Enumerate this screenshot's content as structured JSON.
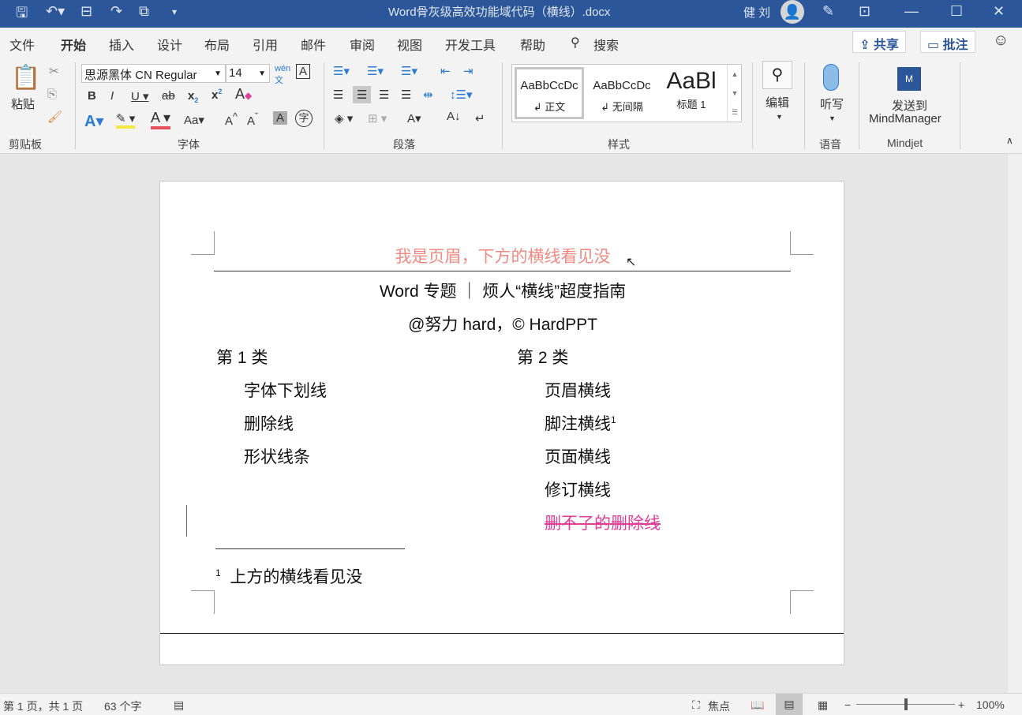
{
  "window": {
    "title": "Word骨灰级高效功能域代码（横线）.docx",
    "user": "健 刘"
  },
  "tabs": [
    "文件",
    "开始",
    "插入",
    "设计",
    "布局",
    "引用",
    "邮件",
    "审阅",
    "视图",
    "开发工具",
    "帮助"
  ],
  "search_label": "搜索",
  "share_label": "共享",
  "comment_label": "批注",
  "ribbon": {
    "paste": "粘贴",
    "clipboard": "剪贴板",
    "font_name": "思源黑体 CN Regular",
    "font_size": "14",
    "font_group": "字体",
    "paragraph_group": "段落",
    "styles": [
      {
        "preview": "AaBbCcDc",
        "name": "↲ 正文"
      },
      {
        "preview": "AaBbCcDc",
        "name": "↲ 无间隔"
      },
      {
        "preview": "AaBl",
        "name": "标题 1"
      }
    ],
    "styles_group": "样式",
    "edit": "编辑",
    "dictate": "听写",
    "voice_group": "语音",
    "send_to": "发送到",
    "mindmanager": "MindManager",
    "mindjet_group": "Mindjet"
  },
  "document": {
    "header": "我是页眉，下方的横线看见没",
    "title": "Word 专题 ｜ 烦人“横线”超度指南",
    "subtitle": "@努力 hard，© HardPPT",
    "col1": {
      "heading": "第 1 类",
      "items": [
        "字体下划线",
        "删除线",
        "形状线条"
      ]
    },
    "col2": {
      "heading": "第 2 类",
      "items": [
        "页眉横线",
        "脚注横线",
        "页面横线",
        "修订横线",
        "删不了的删除线"
      ],
      "footnote_ref": "1"
    },
    "footnote": {
      "num": "1",
      "text": "上方的横线看见没"
    }
  },
  "status": {
    "page": "第 1 页，共 1 页",
    "words": "63 个字",
    "focus": "焦点",
    "zoom": "100%"
  },
  "colors": {
    "accent": "#2b579a",
    "header_text": "#f08a82",
    "revision": "#e0409a"
  }
}
